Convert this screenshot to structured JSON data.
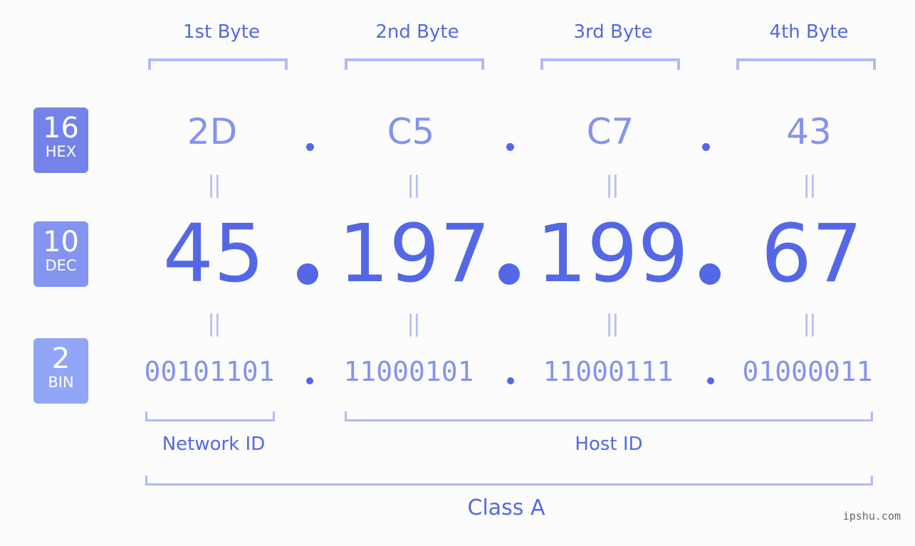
{
  "colors": {
    "accent": "#5468e6",
    "hex_text": "#8593ee",
    "bracket": "#b0b9f6",
    "badge_hex": "#7383ea",
    "badge_dec": "#8594f1",
    "badge_bin": "#91a6f7",
    "background": "#fbfcfb"
  },
  "byte_headers": [
    "1st Byte",
    "2nd Byte",
    "3rd Byte",
    "4th Byte"
  ],
  "badges": [
    {
      "base": "16",
      "label": "HEX"
    },
    {
      "base": "10",
      "label": "DEC"
    },
    {
      "base": "2",
      "label": "BIN"
    }
  ],
  "hex_values": [
    "2D",
    "C5",
    "C7",
    "43"
  ],
  "dec_values": [
    "45",
    "197",
    "199",
    "67"
  ],
  "bin_values": [
    "00101101",
    "11000101",
    "11000111",
    "01000011"
  ],
  "equals_symbol": "||",
  "network_id_label": "Network ID",
  "host_id_label": "Host ID",
  "class_label": "Class A",
  "watermark": "ipshu.com"
}
